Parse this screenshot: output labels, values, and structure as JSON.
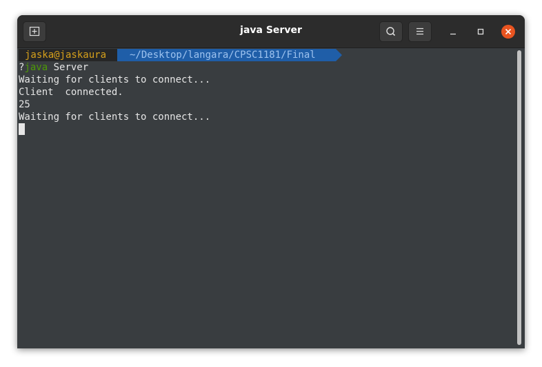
{
  "window": {
    "title": "java Server"
  },
  "terminal": {
    "prompt_user": "jaska@jaskaura",
    "prompt_path": "~/Desktop/langara/CPSC1181/Final",
    "command_prefix": "?",
    "command_program": "java",
    "command_args": " Server",
    "output_lines": [
      "Waiting for clients to connect...",
      "Client  connected.",
      "25",
      "Waiting for clients to connect..."
    ]
  },
  "colors": {
    "prompt_user": "#d7a11b",
    "prompt_path_bg": "#1f5ea8",
    "command_program": "#4e9a06",
    "close_button": "#e95420"
  },
  "icons": {
    "new_tab": "new-tab-icon",
    "search": "search-icon",
    "menu": "hamburger-menu-icon",
    "minimize": "minimize-icon",
    "maximize": "maximize-icon",
    "close": "close-icon"
  }
}
